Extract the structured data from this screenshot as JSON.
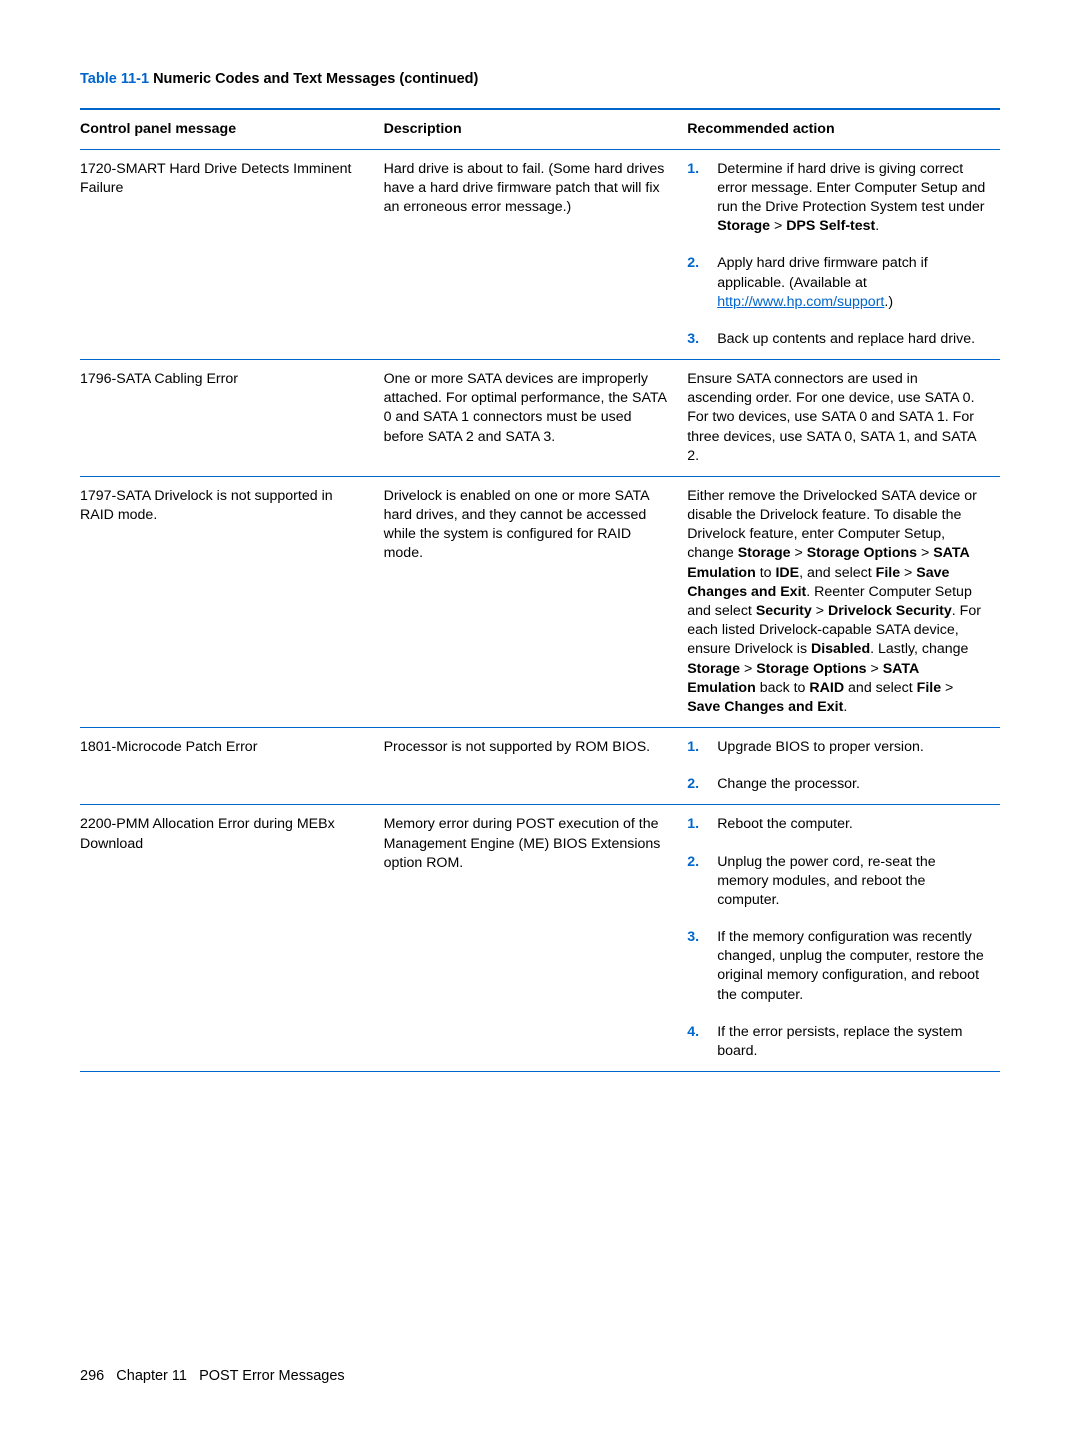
{
  "table_title_num": "Table 11-1",
  "table_title_rest": "  Numeric Codes and Text Messages (continued)",
  "headers": [
    "Control panel message",
    "Description",
    "Recommended action"
  ],
  "rows": [
    {
      "msg": "1720-SMART Hard Drive Detects Imminent Failure",
      "desc": "Hard drive is about to fail. (Some hard drives have a hard drive firmware patch that will fix an erroneous error message.)",
      "rec_type": "list",
      "rec": [
        {
          "n": "1.",
          "t": "Determine if hard drive is giving correct error message. Enter Computer Setup and run the Drive Protection System test under <b>Storage</b> > <b>DPS Self-test</b>."
        },
        {
          "n": "2.",
          "t": "Apply hard drive firmware patch if applicable. (Available at <a class='link' href='#'>http://www.hp.com/support</a>.)"
        },
        {
          "n": "3.",
          "t": "Back up contents and replace hard drive."
        }
      ]
    },
    {
      "msg": "1796-SATA Cabling Error",
      "desc": "One or more SATA devices are improperly attached. For optimal performance, the SATA 0 and SATA 1 connectors must be used before SATA 2 and SATA 3.",
      "rec_type": "plain",
      "rec_plain": "Ensure SATA connectors are used in ascending order. For one device, use SATA 0. For two devices, use SATA 0 and SATA 1. For three devices, use SATA 0, SATA 1, and SATA 2."
    },
    {
      "msg": "1797-SATA Drivelock is not supported in RAID mode.",
      "desc": "Drivelock is enabled on one or more SATA hard drives, and they cannot be accessed while the system is configured for RAID mode.",
      "rec_type": "html",
      "rec_html": "Either remove the Drivelocked SATA device or disable the Drivelock feature. To disable the Drivelock feature, enter Computer Setup, change <b>Storage</b> > <b>Storage Options</b> > <b>SATA Emulation</b> to <b>IDE</b>, and select <b>File</b> > <b>Save Changes and Exit</b>. Reenter Computer Setup and select <b>Security</b> > <b>Drivelock Security</b>. For each listed Drivelock-capable SATA device, ensure Drivelock is <b>Disabled</b>. Lastly, change <b>Storage</b> > <b>Storage Options</b> > <b>SATA Emulation</b> back to <b>RAID</b> and select <b>File</b> > <b>Save Changes and Exit</b>."
    },
    {
      "msg": "1801-Microcode Patch Error",
      "desc": "Processor is not supported by ROM BIOS.",
      "rec_type": "list",
      "rec": [
        {
          "n": "1.",
          "t": "Upgrade BIOS to proper version."
        },
        {
          "n": "2.",
          "t": "Change the processor."
        }
      ]
    },
    {
      "msg": "2200-PMM Allocation Error during MEBx Download",
      "desc": "Memory error during POST execution of the Management Engine (ME) BIOS Extensions option ROM.",
      "rec_type": "list",
      "rec": [
        {
          "n": "1.",
          "t": "Reboot the computer."
        },
        {
          "n": "2.",
          "t": "Unplug the power cord, re-seat the memory modules, and reboot the computer."
        },
        {
          "n": "3.",
          "t": "If the memory configuration was recently changed, unplug the computer, restore the original memory configuration, and reboot the computer."
        },
        {
          "n": "4.",
          "t": "If the error persists, replace the system board."
        }
      ]
    }
  ],
  "footer_page": "296",
  "footer_chapter": "Chapter 11",
  "footer_title": "POST Error Messages"
}
